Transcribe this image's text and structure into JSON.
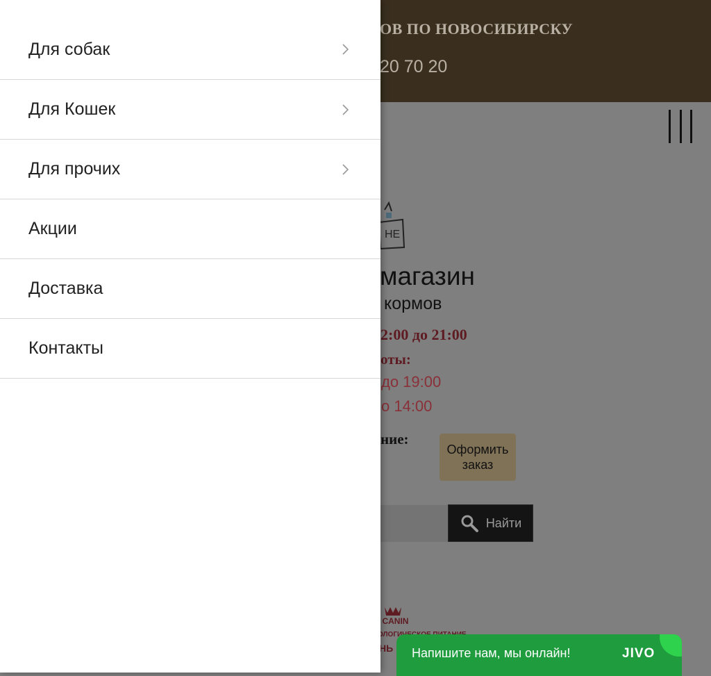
{
  "background": {
    "header_title": "ОВ ПО НОВОСИБИРСКУ",
    "header_phone": "20 70 20",
    "shop_title": "магазин",
    "shop_subtitle": "кормов",
    "hours": "2:00 до 21:00",
    "work_label": "оты:",
    "work_line1": "до 19:00",
    "work_line2": "о 14:00",
    "phone_label": "ние:",
    "order_button": "Оформить заказ",
    "search_button": "Найти",
    "brand_logo_text": "L CANIN",
    "brand_logo_subtext": "ОЛОГИЧЕСКОЕ ПИТАНИЕ"
  },
  "menu": {
    "items": [
      {
        "label": "Для собак",
        "has_submenu": true
      },
      {
        "label": "Для Кошек",
        "has_submenu": true
      },
      {
        "label": "Для прочих",
        "has_submenu": true
      },
      {
        "label": "Акции",
        "has_submenu": false
      },
      {
        "label": "Доставка",
        "has_submenu": false
      },
      {
        "label": "Контакты",
        "has_submenu": false
      }
    ]
  },
  "chat": {
    "text": "Напишите нам, мы онлайн!",
    "logo": "JIVO"
  },
  "colors": {
    "header_bg": "#3a2f1f",
    "chat_bg": "#1f9c3e",
    "accent_red": "#8a3038"
  }
}
